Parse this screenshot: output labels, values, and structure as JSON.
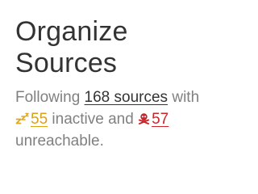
{
  "header": {
    "title_line1": "Organize",
    "title_line2": "Sources"
  },
  "summary": {
    "prefix": "Following ",
    "total_sources_link": "168 sources",
    "after_total": " with",
    "inactive_icon": "sleeping-zzz-icon",
    "inactive_count": "55",
    "after_inactive": " inactive and ",
    "unreachable_icon": "skull-crossbones-icon",
    "unreachable_count": "57",
    "suffix": "unreachable."
  },
  "colors": {
    "title": "#333333",
    "body_text": "#808080",
    "inactive_accent": "#d9a216",
    "unreachable_accent": "#c8262b"
  }
}
